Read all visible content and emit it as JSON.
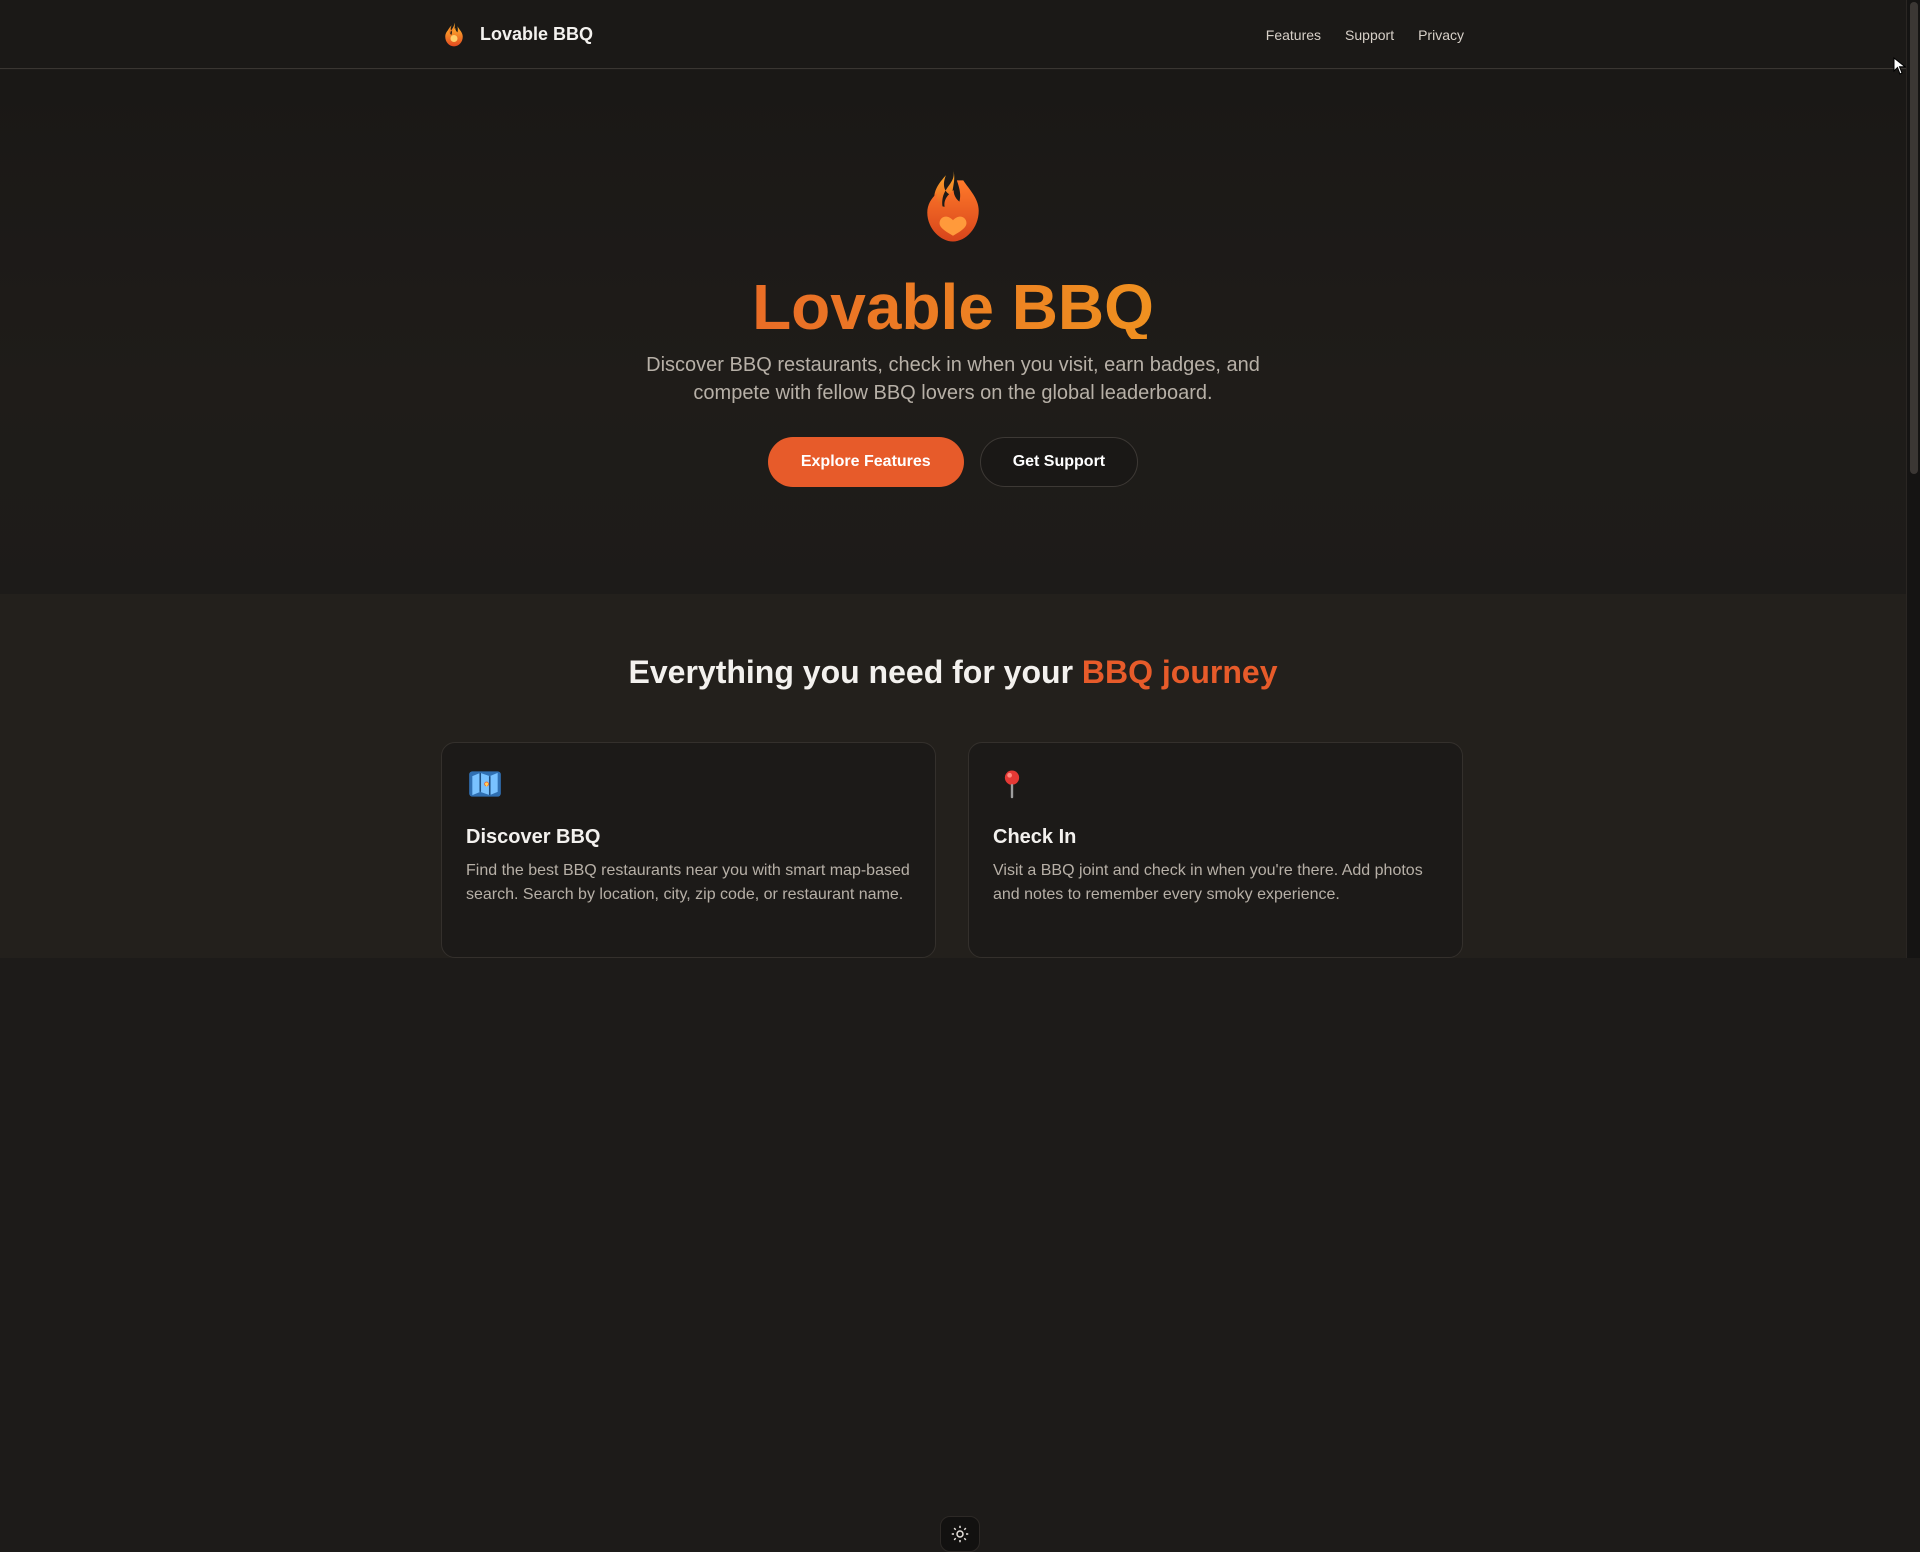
{
  "brand": {
    "title": "Lovable BBQ"
  },
  "nav": {
    "items": [
      "Features",
      "Support",
      "Privacy"
    ]
  },
  "hero": {
    "title": "Lovable BBQ",
    "subtitle": "Discover BBQ restaurants, check in when you visit, earn badges, and compete with fellow BBQ lovers on the global leaderboard.",
    "cta_primary": "Explore Features",
    "cta_secondary": "Get Support"
  },
  "features": {
    "title_prefix": "Everything you need for your ",
    "title_accent": "BBQ journey",
    "cards": [
      {
        "icon": "map-icon",
        "title": "Discover BBQ",
        "text": "Find the best BBQ restaurants near you with smart map-based search. Search by location, city, zip code, or restaurant name."
      },
      {
        "icon": "pin-icon",
        "title": "Check In",
        "text": "Visit a BBQ joint and check in when you're there. Add photos and notes to remember every smoky experience."
      }
    ]
  },
  "colors": {
    "accent": "#E75B2A",
    "accent_secondary": "#F2A21C",
    "background": "#1D1B19"
  }
}
